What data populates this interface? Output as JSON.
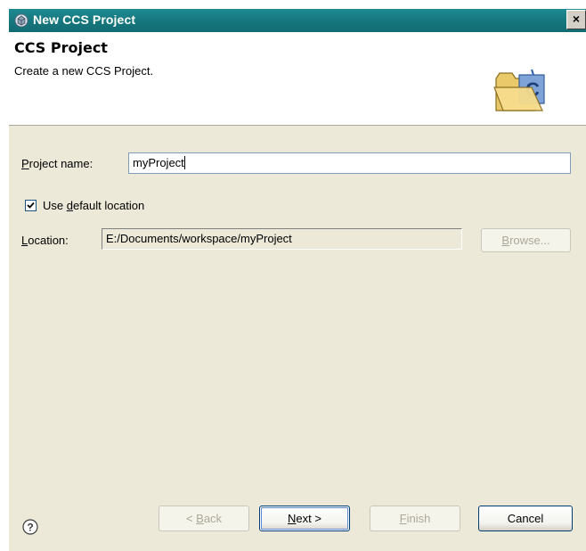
{
  "window": {
    "title": "New CCS Project",
    "close_label": "×"
  },
  "banner": {
    "title": "CCS Project",
    "description": "Create a new CCS Project."
  },
  "form": {
    "project_name": {
      "label_mnemonic": "P",
      "label_rest": "roject name:",
      "value": "myProject"
    },
    "use_default_location": {
      "checked": true,
      "label_before": "Use ",
      "label_mnemonic": "d",
      "label_after": "efault location"
    },
    "location": {
      "label_mnemonic": "L",
      "label_rest": "ocation:",
      "value": "E:/Documents/workspace/myProject"
    },
    "browse_button": {
      "mnemonic": "B",
      "rest": "rowse...",
      "enabled": false
    }
  },
  "buttons": {
    "back": {
      "prefix": "< ",
      "mnemonic": "B",
      "rest": "ack",
      "enabled": false
    },
    "next": {
      "mnemonic": "N",
      "rest": "ext >",
      "enabled": true
    },
    "finish": {
      "mnemonic": "F",
      "rest": "inish",
      "enabled": false
    },
    "cancel": {
      "label": "Cancel",
      "enabled": true
    }
  },
  "icons": {
    "window_icon": "ccs-project-icon",
    "banner_icon": "new-project-folder-icon",
    "help_icon": "help-icon"
  },
  "colors": {
    "titlebar": "#16767d",
    "dialog_bg": "#ece9d8",
    "button_border": "#003c74"
  }
}
